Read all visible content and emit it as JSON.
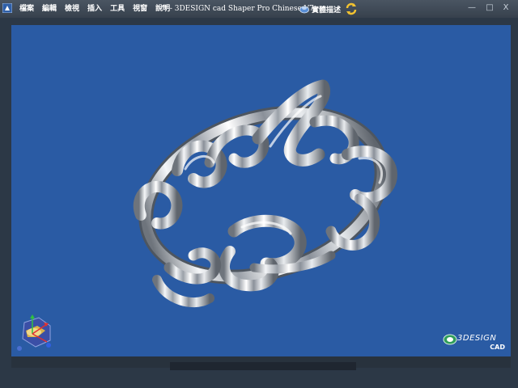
{
  "menu": {
    "items": [
      {
        "label": "檔案"
      },
      {
        "label": "編輯"
      },
      {
        "label": "檢視"
      },
      {
        "label": "插入"
      },
      {
        "label": "工具"
      },
      {
        "label": "視窗"
      },
      {
        "label": "說明"
      }
    ]
  },
  "title": {
    "text": "'* - 3DESIGN cad Shaper Pro Chinese V7"
  },
  "toolbar": {
    "help_label": "實體描述"
  },
  "window": {
    "minimize_glyph": "—",
    "maximize_glyph": "□",
    "close_glyph": "X"
  },
  "brand": {
    "name": "3DESIGN",
    "tag": "CAD"
  },
  "icons": [
    "app-icon",
    "help-icon",
    "refresh-icon",
    "axis-cube-icon",
    "brand-logo-icon"
  ],
  "colors": {
    "viewport_bg": "#2a5ba4",
    "titlebar_bg": "#3f4a56",
    "model_metal": "#c8ccd2"
  }
}
